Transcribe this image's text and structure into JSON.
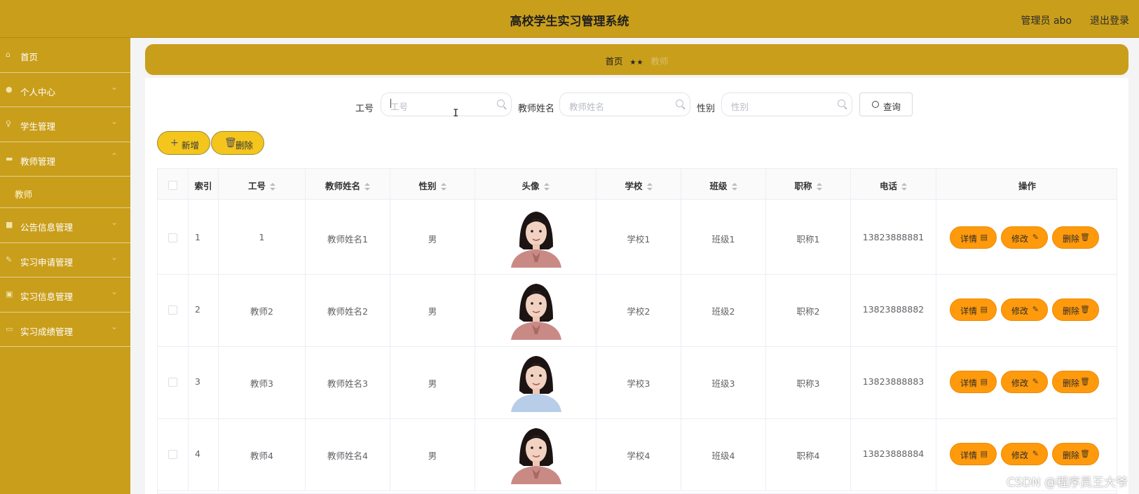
{
  "header": {
    "title": "高校学生实习管理系统",
    "user": "管理员 abo",
    "logout": "退出登录"
  },
  "sidebar": {
    "items": [
      {
        "label": "首页",
        "icon": "home-icon"
      },
      {
        "label": "个人中心",
        "icon": "user-icon"
      },
      {
        "label": "学生管理",
        "icon": "student-icon"
      },
      {
        "label": "教师管理",
        "icon": "teacher-icon"
      },
      {
        "label": "公告信息管理",
        "icon": "notice-icon"
      },
      {
        "label": "实习申请管理",
        "icon": "apply-icon"
      },
      {
        "label": "实习信息管理",
        "icon": "info-icon"
      },
      {
        "label": "实习成绩管理",
        "icon": "score-icon"
      }
    ],
    "subitem": "教师"
  },
  "breadcrumb": {
    "home": "首页",
    "separator": "★★",
    "current": "教师"
  },
  "search": {
    "field1_label": "工号",
    "field1_placeholder": "工号",
    "field2_label": "教师姓名",
    "field2_placeholder": "教师姓名",
    "field3_label": "性别",
    "field3_placeholder": "性别",
    "query_label": "查询"
  },
  "toolbar": {
    "add_label": "新增",
    "delete_label": "删除"
  },
  "table": {
    "columns": [
      "索引",
      "工号",
      "教师姓名",
      "性别",
      "头像",
      "学校",
      "班级",
      "职称",
      "电话",
      "操作"
    ],
    "rows": [
      {
        "idx": "1",
        "id": "1",
        "name": "教师姓名1",
        "gender": "男",
        "school": "学校1",
        "class": "班级1",
        "title": "职称1",
        "phone": "13823888881"
      },
      {
        "idx": "2",
        "id": "教师2",
        "name": "教师姓名2",
        "gender": "男",
        "school": "学校2",
        "class": "班级2",
        "title": "职称2",
        "phone": "13823888882"
      },
      {
        "idx": "3",
        "id": "教师3",
        "name": "教师姓名3",
        "gender": "男",
        "school": "学校3",
        "class": "班级3",
        "title": "职称3",
        "phone": "13823888883"
      },
      {
        "idx": "4",
        "id": "教师4",
        "name": "教师姓名4",
        "gender": "男",
        "school": "学校4",
        "class": "班级4",
        "title": "职称4",
        "phone": "13823888884"
      }
    ],
    "actions": {
      "detail": "详情",
      "edit": "修改",
      "delete": "删除"
    }
  },
  "watermark": "CSDN @程序员王大爷",
  "colors": {
    "header": "#c99e1b",
    "sidebar": "#c99e1b",
    "action_button": "#ff9a0d",
    "toolbar_button": "#f3c51d"
  }
}
